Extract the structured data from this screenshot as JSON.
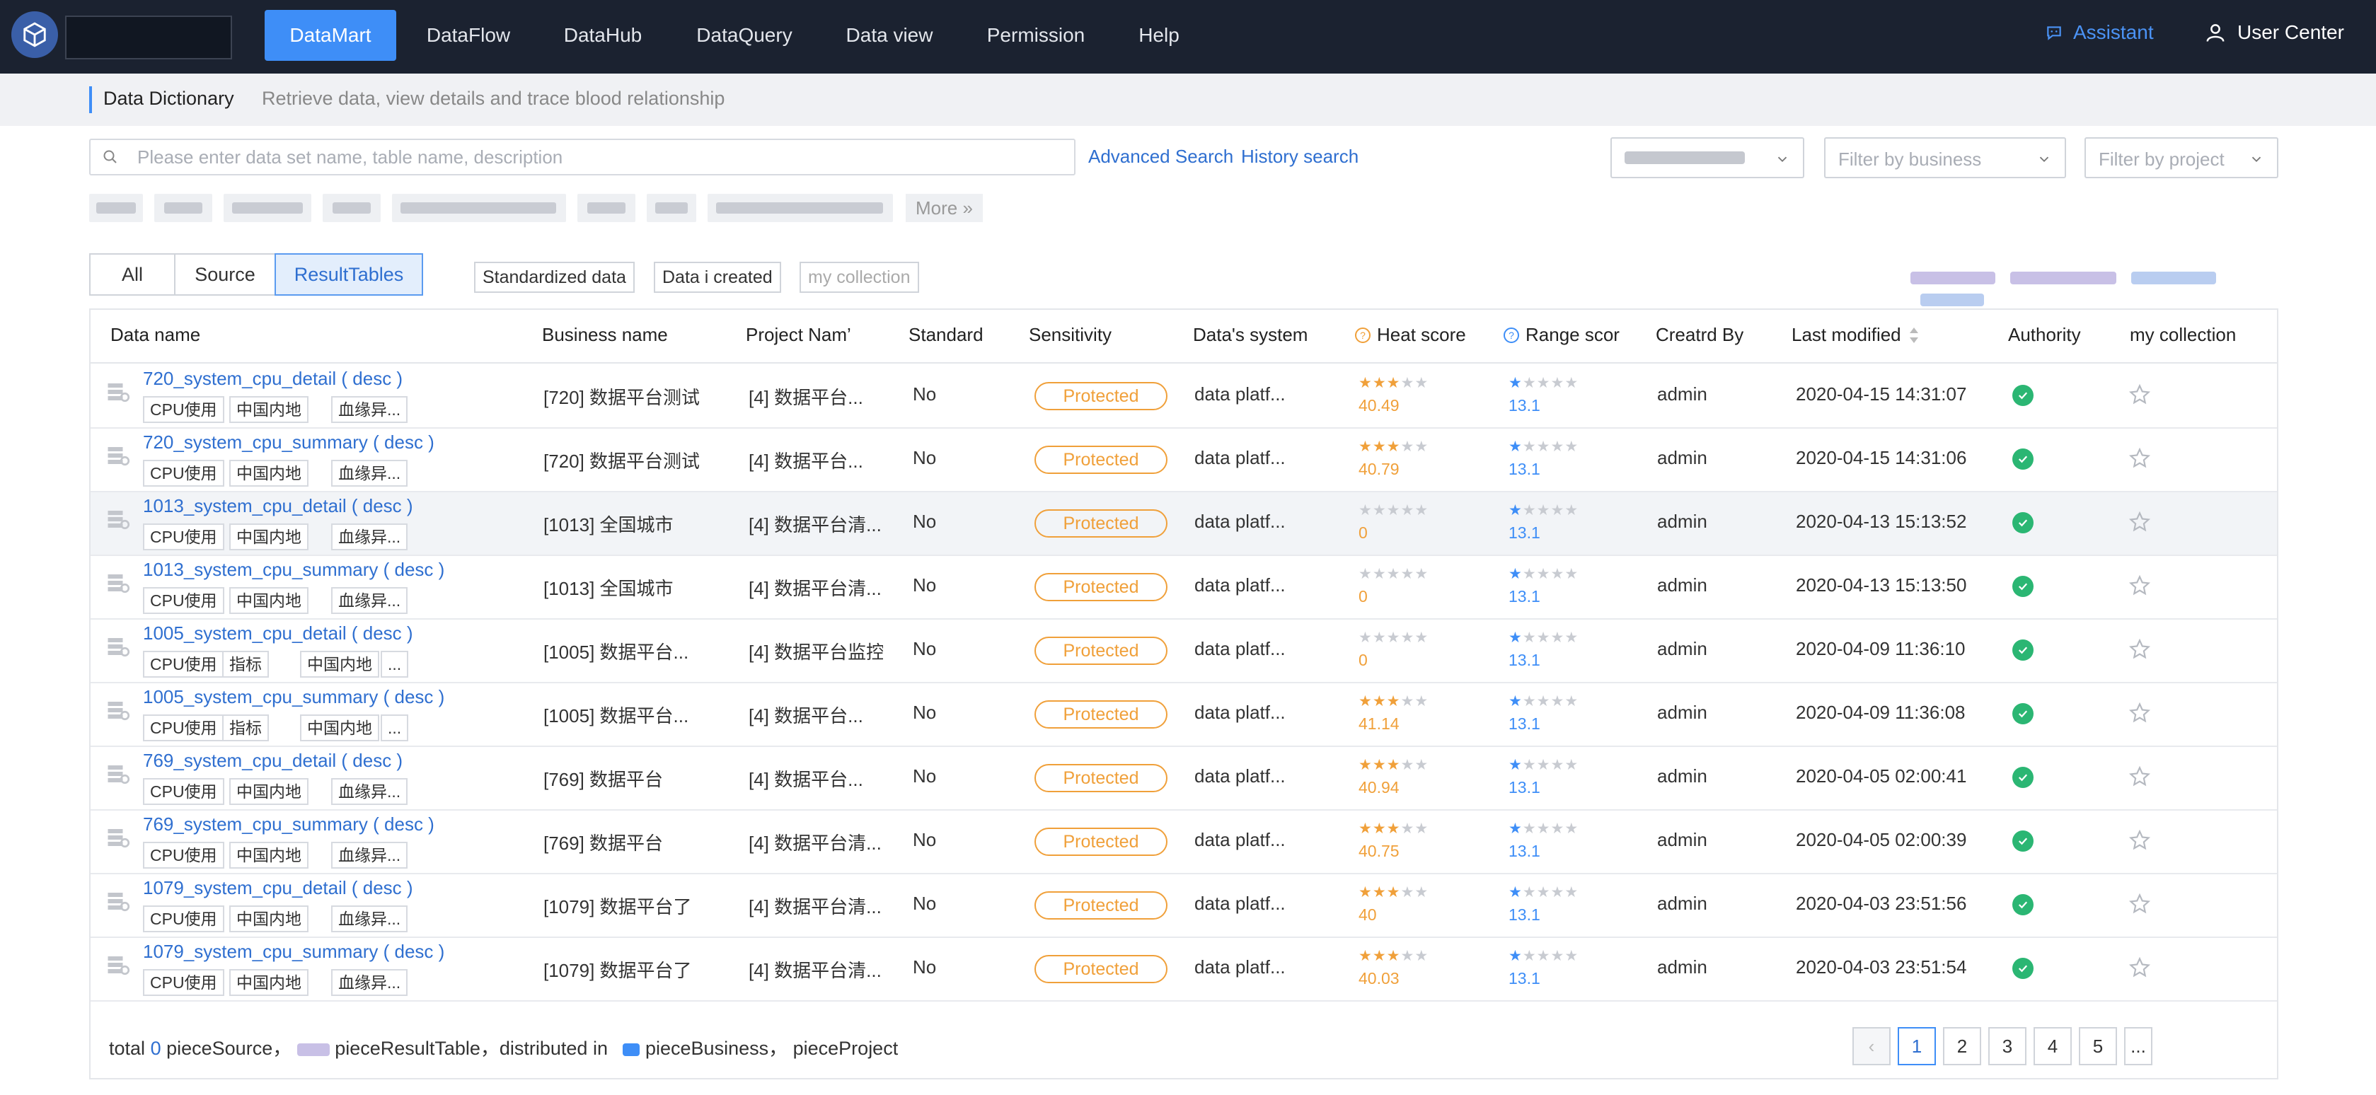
{
  "nav": {
    "items": [
      "DataMart",
      "DataFlow",
      "DataHub",
      "DataQuery",
      "Data view",
      "Permission",
      "Help"
    ],
    "active": "DataMart",
    "assistant": "Assistant",
    "user_center": "User Center"
  },
  "breadcrumb": {
    "title": "Data Dictionary",
    "description": "Retrieve data, view details and trace blood relationship"
  },
  "search": {
    "placeholder": "Please enter data set name, table name, description",
    "advanced": "Advanced Search",
    "history": "History search"
  },
  "filters": {
    "business_placeholder": "Filter by business",
    "project_placeholder": "Filter by project"
  },
  "more_label": "More »",
  "segments": [
    "All",
    "Source",
    "ResultTables"
  ],
  "active_segment": "ResultTables",
  "filter_buttons": [
    "Standardized data",
    "Data i created",
    "my collection"
  ],
  "table": {
    "headers": {
      "data_name": "Data name",
      "business_name": "Business name",
      "project_name": "Project Nam’",
      "standard": "Standard",
      "sensitivity": "Sensitivity",
      "system": "Data's system",
      "heat": "Heat score",
      "range": "Range scor",
      "created_by": "Creatrd By",
      "last_modified": "Last modified",
      "authority": "Authority",
      "collection": "my collection"
    },
    "rows": [
      {
        "name": "720_system_cpu_detail ( desc )",
        "tags": [
          "CPU使用",
          "中国内地",
          "血缘异..."
        ],
        "business": "[720] 数据平台测试",
        "project": "[4] 数据平台...",
        "standard": "No",
        "sensitivity": "Protected",
        "system": "data platf...",
        "heat_stars": 2.5,
        "heat": "40.49",
        "range_stars": 0.5,
        "range": "13.1",
        "created_by": "admin",
        "modified": "2020-04-15 14:31:07"
      },
      {
        "name": "720_system_cpu_summary ( desc )",
        "tags": [
          "CPU使用",
          "中国内地",
          "血缘异..."
        ],
        "business": "[720] 数据平台测试",
        "project": "[4] 数据平台...",
        "standard": "No",
        "sensitivity": "Protected",
        "system": "data platf...",
        "heat_stars": 2.5,
        "heat": "40.79",
        "range_stars": 0.5,
        "range": "13.1",
        "created_by": "admin",
        "modified": "2020-04-15 14:31:06"
      },
      {
        "name": "1013_system_cpu_detail ( desc )",
        "tags": [
          "CPU使用",
          "中国内地",
          "血缘异..."
        ],
        "business": "[1013] 全国城市",
        "project": "[4] 数据平台清...",
        "standard": "No",
        "sensitivity": "Protected",
        "system": "data platf...",
        "heat_stars": 0,
        "heat": "0",
        "range_stars": 0.5,
        "range": "13.1",
        "created_by": "admin",
        "modified": "2020-04-13 15:13:52"
      },
      {
        "name": "1013_system_cpu_summary ( desc )",
        "tags": [
          "CPU使用",
          "中国内地",
          "血缘异..."
        ],
        "business": "[1013] 全国城市",
        "project": "[4] 数据平台清...",
        "standard": "No",
        "sensitivity": "Protected",
        "system": "data platf...",
        "heat_stars": 0,
        "heat": "0",
        "range_stars": 0.5,
        "range": "13.1",
        "created_by": "admin",
        "modified": "2020-04-13 15:13:50"
      },
      {
        "name": "1005_system_cpu_detail ( desc )",
        "tags": [
          "CPU使用",
          "指标",
          "中国内地",
          "..."
        ],
        "business": "[1005] 数据平台...",
        "project": "[4] 数据平台监控",
        "standard": "No",
        "sensitivity": "Protected",
        "system": "data platf...",
        "heat_stars": 0,
        "heat": "0",
        "range_stars": 0.5,
        "range": "13.1",
        "created_by": "admin",
        "modified": "2020-04-09 11:36:10"
      },
      {
        "name": "1005_system_cpu_summary ( desc )",
        "tags": [
          "CPU使用",
          "指标",
          "中国内地",
          "..."
        ],
        "business": "[1005] 数据平台...",
        "project": "[4] 数据平台...",
        "standard": "No",
        "sensitivity": "Protected",
        "system": "data platf...",
        "heat_stars": 2.5,
        "heat": "41.14",
        "range_stars": 0.5,
        "range": "13.1",
        "created_by": "admin",
        "modified": "2020-04-09 11:36:08"
      },
      {
        "name": "769_system_cpu_detail ( desc )",
        "tags": [
          "CPU使用",
          "中国内地",
          "血缘异..."
        ],
        "business": "[769] 数据平台",
        "project": "[4] 数据平台...",
        "standard": "No",
        "sensitivity": "Protected",
        "system": "data platf...",
        "heat_stars": 2.5,
        "heat": "40.94",
        "range_stars": 0.5,
        "range": "13.1",
        "created_by": "admin",
        "modified": "2020-04-05 02:00:41"
      },
      {
        "name": "769_system_cpu_summary ( desc )",
        "tags": [
          "CPU使用",
          "中国内地",
          "血缘异..."
        ],
        "business": "[769] 数据平台",
        "project": "[4] 数据平台清...",
        "standard": "No",
        "sensitivity": "Protected",
        "system": "data platf...",
        "heat_stars": 2.5,
        "heat": "40.75",
        "range_stars": 0.5,
        "range": "13.1",
        "created_by": "admin",
        "modified": "2020-04-05 02:00:39"
      },
      {
        "name": "1079_system_cpu_detail ( desc )",
        "tags": [
          "CPU使用",
          "中国内地",
          "血缘异..."
        ],
        "business": "[1079] 数据平台了",
        "project": "[4] 数据平台清...",
        "standard": "No",
        "sensitivity": "Protected",
        "system": "data platf...",
        "heat_stars": 2.5,
        "heat": "40",
        "range_stars": 0.5,
        "range": "13.1",
        "created_by": "admin",
        "modified": "2020-04-03 23:51:56"
      },
      {
        "name": "1079_system_cpu_summary ( desc )",
        "tags": [
          "CPU使用",
          "中国内地",
          "血缘异..."
        ],
        "business": "[1079] 数据平台了",
        "project": "[4] 数据平台清...",
        "standard": "No",
        "sensitivity": "Protected",
        "system": "data platf...",
        "heat_stars": 2.5,
        "heat": "40.03",
        "range_stars": 0.5,
        "range": "13.1",
        "created_by": "admin",
        "modified": "2020-04-03 23:51:54"
      }
    ]
  },
  "footer": {
    "total_label": "total",
    "source_count": "0",
    "source_label": "pieceSource，",
    "result_label": "pieceResultTable，distributed in",
    "business_label": "pieceBusiness，",
    "project_label": "pieceProject"
  },
  "pagination": {
    "prev": "‹",
    "pages": [
      "1",
      "2",
      "3",
      "4",
      "5",
      "..."
    ],
    "current": "1"
  },
  "colors": {
    "nav_bg": "#1b2230",
    "accent": "#3e8ef7",
    "link": "#2f6fd0",
    "protected": "#f0a03a",
    "authority": "#2bb673"
  }
}
